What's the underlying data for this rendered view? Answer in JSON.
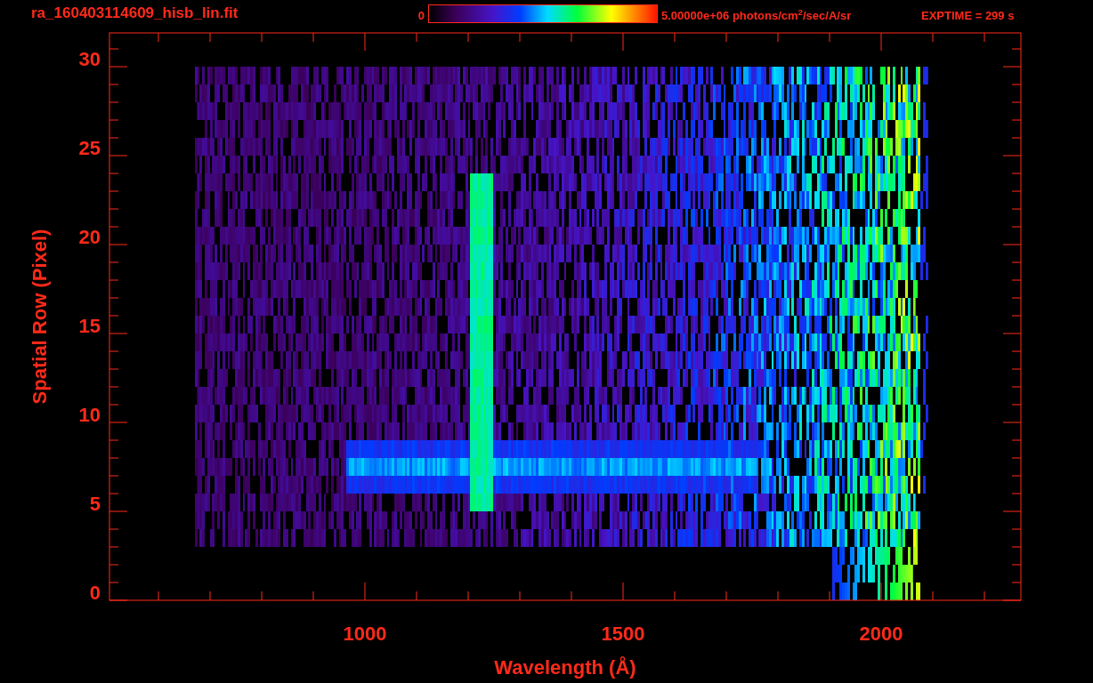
{
  "header": {
    "filename": "ra_160403114609_hisb_lin.fit",
    "colorbar_min": "0",
    "colorbar_max": "5.00000e+06 photons/cm$^{2}$/sec/A/sr",
    "exptime": "EXPTIME = 299 s"
  },
  "plot": {
    "xlabel": "Wavelength (Å)",
    "ylabel": "Spatial Row (Pixel)",
    "xticks": [
      "1000",
      "1500",
      "2000"
    ],
    "yticks": [
      "30",
      "25",
      "20",
      "15",
      "10",
      "5",
      "0"
    ]
  }
}
